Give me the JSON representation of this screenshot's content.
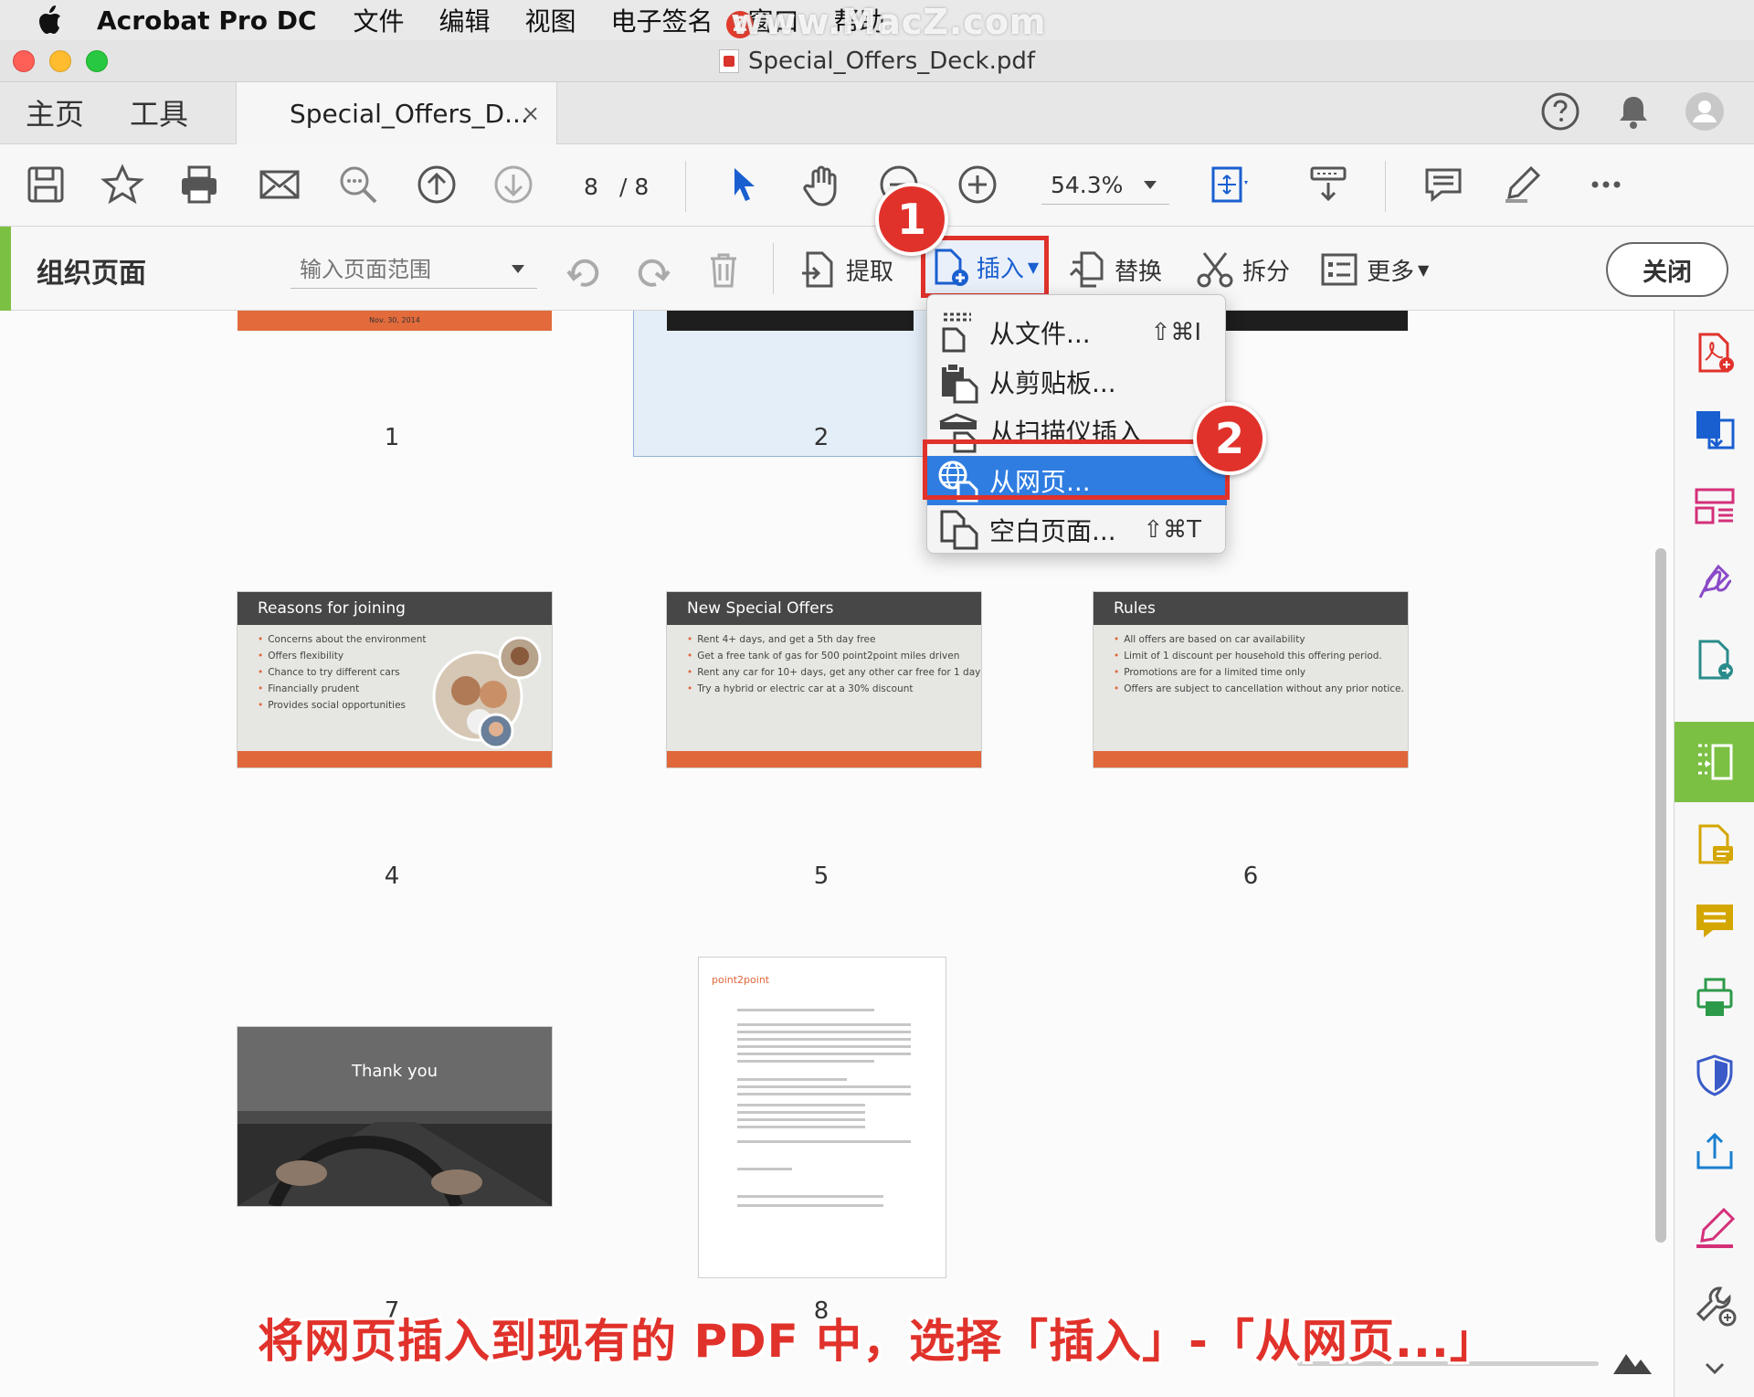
{
  "menubar": {
    "app_name": "Acrobat Pro DC",
    "menus": [
      "文件",
      "编辑",
      "视图",
      "电子签名",
      "窗口",
      "帮助"
    ],
    "watermark": "www.MacZ.com",
    "watermark_badge": "Z"
  },
  "window": {
    "title": "Special_Offers_Deck.pdf"
  },
  "tabs": {
    "home": "主页",
    "tools": "工具",
    "document": "Special_Offers_D...",
    "close_symbol": "×"
  },
  "toolbar": {
    "page_current": "8",
    "page_total": "/ 8",
    "zoom": "54.3%"
  },
  "organize": {
    "title": "组织页面",
    "range_placeholder": "输入页面范围",
    "extract": "提取",
    "insert": "插入",
    "replace": "替换",
    "split": "拆分",
    "more": "更多",
    "close": "关闭"
  },
  "insert_menu": {
    "items": [
      {
        "label": "从文件...",
        "shortcut": "⇧⌘I"
      },
      {
        "label": "从剪贴板...",
        "shortcut": ""
      },
      {
        "label": "从扫描仪插入",
        "shortcut": ""
      },
      {
        "label": "从网页...",
        "shortcut": ""
      },
      {
        "label": "空白页面...",
        "shortcut": "⇧⌘T"
      }
    ],
    "selected_index": 3
  },
  "callouts": [
    "1",
    "2"
  ],
  "pages": {
    "labels": [
      "1",
      "2",
      "4",
      "5",
      "6",
      "7",
      "8"
    ],
    "page1_footer": "Nov. 30, 2014",
    "page4": {
      "title": "Reasons for joining",
      "bullets": [
        "Concerns about the environment",
        "Offers flexibility",
        "Chance to try different cars",
        "Financially prudent",
        "Provides social opportunities"
      ]
    },
    "page5": {
      "title": "New Special Offers",
      "bullets": [
        "Rent 4+ days, and get a 5th day free",
        "Get a free tank of gas for 500 point2point miles driven",
        "Rent any car for 10+ days, get any other car free for 1 day",
        "Try a hybrid or electric car at a 30% discount"
      ]
    },
    "page6": {
      "title": "Rules",
      "bullets": [
        "All offers are based on car availability",
        "Limit of 1 discount per household this offering period.",
        "Promotions are for a limited time only",
        "Offers are subject to cancellation without any prior notice."
      ]
    },
    "page7": {
      "title": "Thank you"
    },
    "page8": {
      "logo": "point2point"
    }
  },
  "caption": "将网页插入到现有的 PDF 中，选择「插入」-「从网页...」",
  "colors": {
    "accent_green": "#7bc043",
    "highlight_red": "#e0322b",
    "menu_selected": "#2f7de1",
    "slide_orange": "#e0673a"
  }
}
